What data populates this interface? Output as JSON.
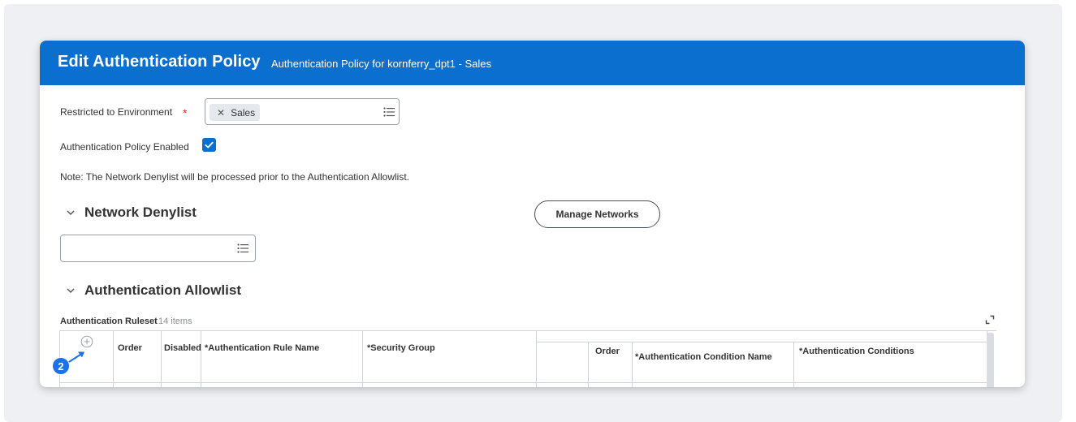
{
  "header": {
    "title": "Edit Authentication Policy",
    "subtitle": "Authentication Policy for kornferry_dpt1 - Sales"
  },
  "form": {
    "restricted_label": "Restricted to Environment",
    "required_marker": "*",
    "environment_value": "Sales",
    "policy_enabled_label": "Authentication Policy Enabled",
    "policy_enabled": true,
    "note": "Note: The Network Denylist will be processed prior to the Authentication Allowlist."
  },
  "network_denylist": {
    "title": "Network Denylist",
    "manage_button": "Manage Networks"
  },
  "allowlist": {
    "title": "Authentication Allowlist",
    "ruleset_label": "Authentication Ruleset",
    "ruleset_count": "14 items",
    "columns": {
      "order": "Order",
      "disabled": "Disabled",
      "rule_name": "*Authentication Rule Name",
      "security_group": "*Security Group",
      "cond_order": "Order",
      "condition_name": "*Authentication Condition Name",
      "conditions": "*Authentication Conditions"
    }
  },
  "annotation": {
    "step_number": "2"
  },
  "colors": {
    "header_bg": "#0b6fd0",
    "required": "#de2e21",
    "badge": "#1a73e8",
    "backdrop": "#eef0f4"
  },
  "icons": [
    "list-icon",
    "close-icon",
    "check-icon",
    "chevron-down-icon",
    "add-icon",
    "expand-icon",
    "arrow-icon"
  ]
}
